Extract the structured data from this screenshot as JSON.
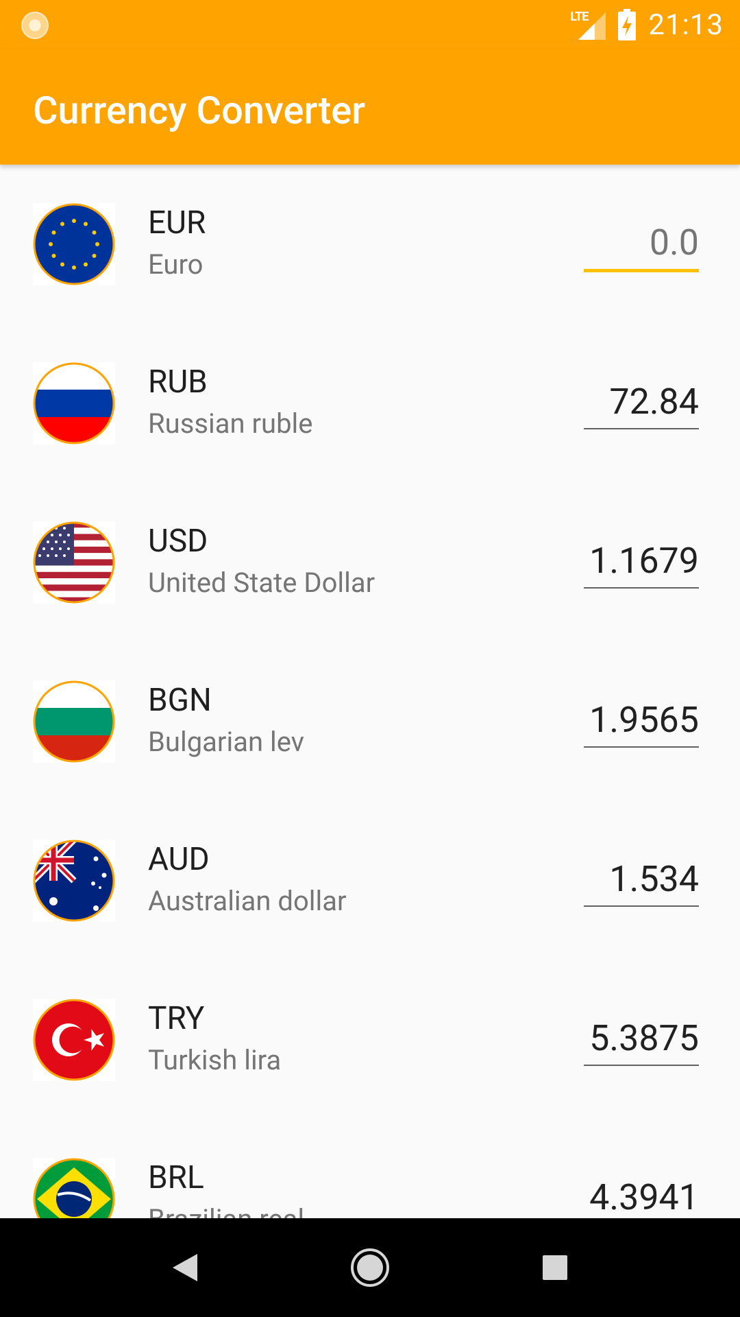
{
  "status_bar": {
    "time": "21:13",
    "network_label": "LTE",
    "icons": [
      "notification-icon",
      "lte-signal-icon",
      "battery-charging-icon"
    ]
  },
  "app_bar": {
    "title": "Currency Converter"
  },
  "currencies": [
    {
      "code": "EUR",
      "name": "Euro",
      "value": "",
      "placeholder": "0.0",
      "flag": "eu-flag-icon"
    },
    {
      "code": "RUB",
      "name": "Russian ruble",
      "value": "72.84",
      "placeholder": "",
      "flag": "russia-flag-icon"
    },
    {
      "code": "USD",
      "name": "United State Dollar",
      "value": "1.1679",
      "placeholder": "",
      "flag": "usa-flag-icon"
    },
    {
      "code": "BGN",
      "name": "Bulgarian lev",
      "value": "1.9565",
      "placeholder": "",
      "flag": "bulgaria-flag-icon"
    },
    {
      "code": "AUD",
      "name": "Australian dollar",
      "value": "1.534",
      "placeholder": "",
      "flag": "australia-flag-icon"
    },
    {
      "code": "TRY",
      "name": "Turkish lira",
      "value": "5.3875",
      "placeholder": "",
      "flag": "turkey-flag-icon"
    },
    {
      "code": "BRL",
      "name": "Brazilian real",
      "value": "4.3941",
      "placeholder": "",
      "flag": "brazil-flag-icon"
    }
  ],
  "nav_bar": {
    "icons": [
      "back-icon",
      "home-icon",
      "recents-icon"
    ]
  },
  "colors": {
    "primary": "#FFA300",
    "accent": "#FFC107"
  }
}
